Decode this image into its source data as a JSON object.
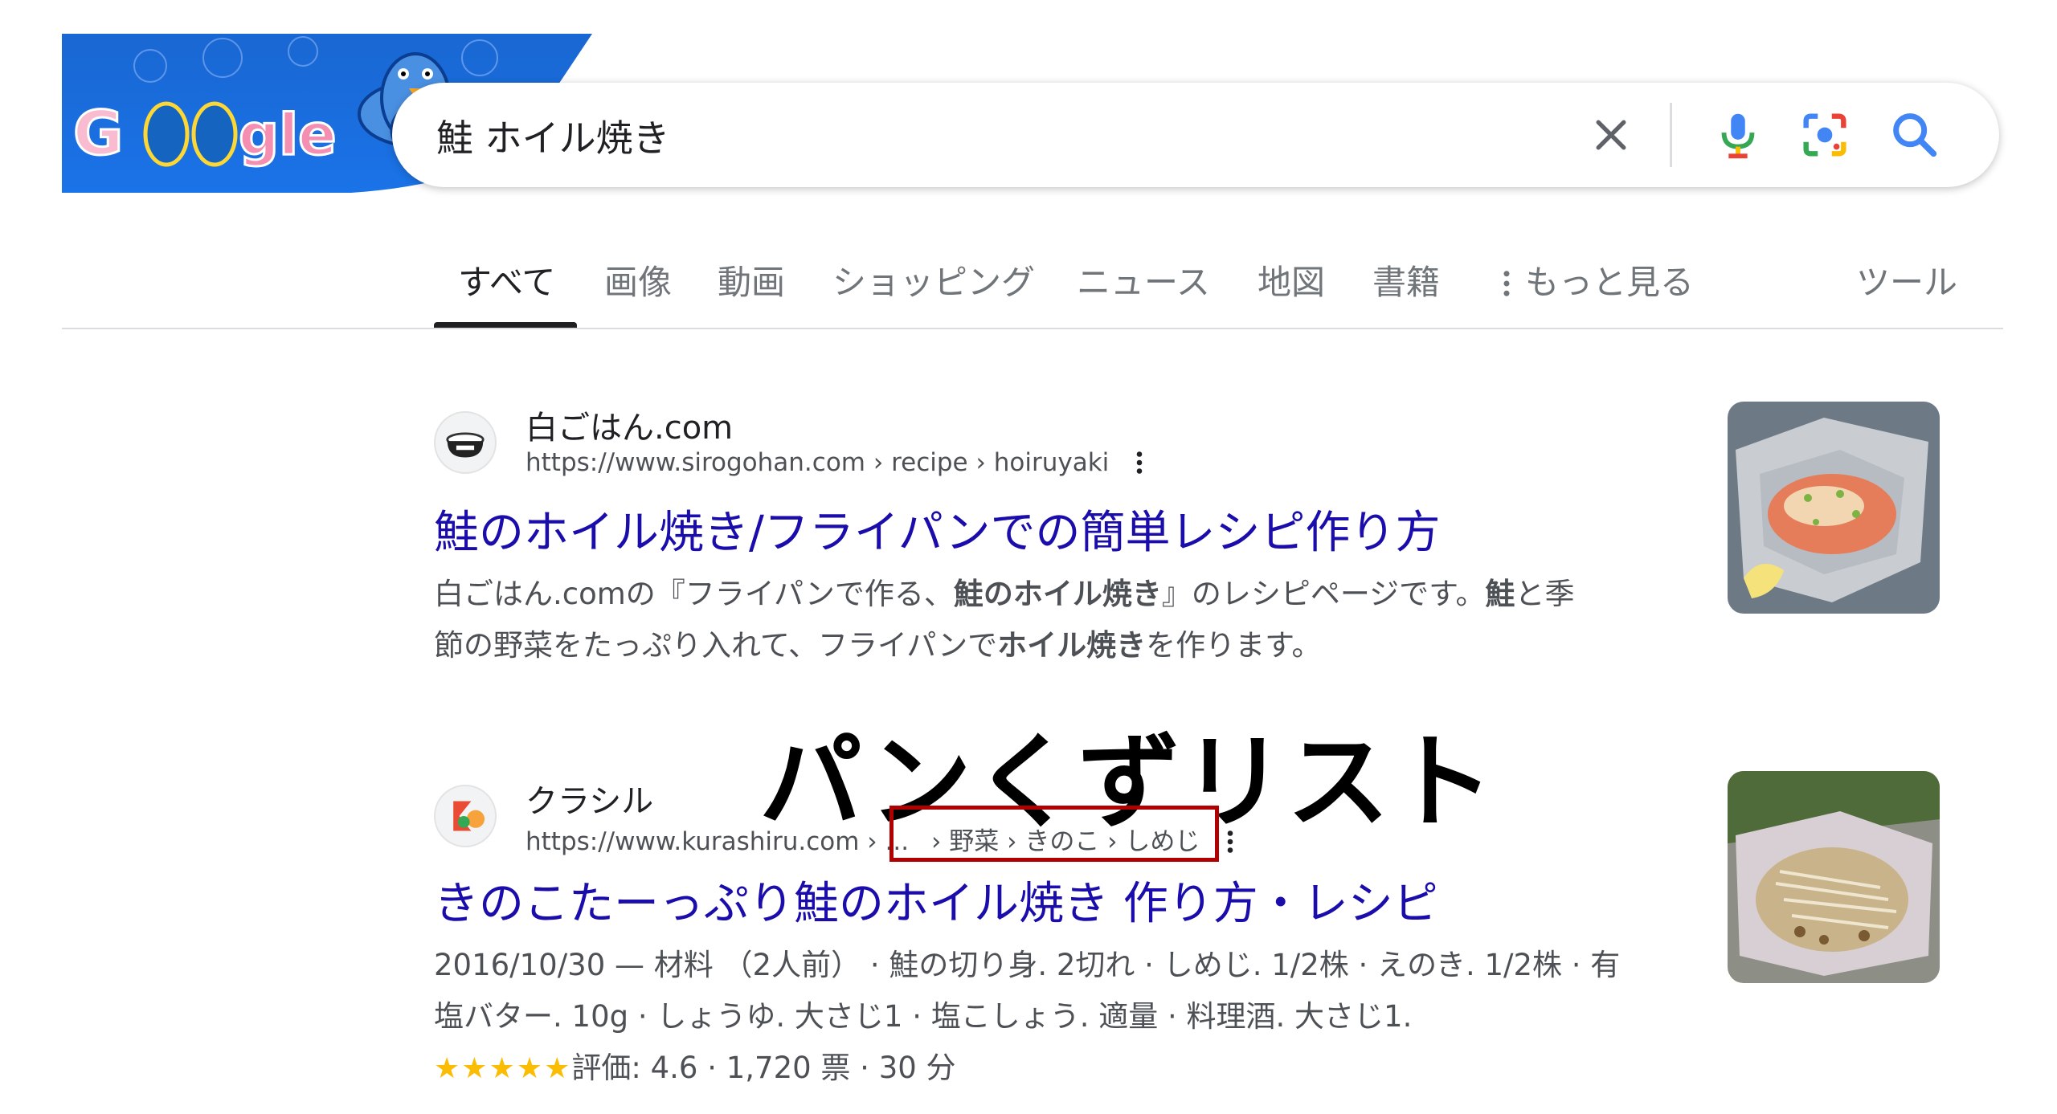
{
  "doodle": {
    "wordmark": "Google",
    "colors": {
      "banner": "#1a73e8",
      "banner_dark": "#0b57d0",
      "mascot": "#4a90e2",
      "mascot_belly": "#f28b82"
    }
  },
  "search": {
    "query": "鮭 ホイル焼き",
    "icons": [
      "close-icon",
      "microphone-icon",
      "google-lens-icon",
      "search-icon"
    ]
  },
  "tabs": {
    "items": [
      "すべて",
      "画像",
      "動画",
      "ショッピング",
      "ニュース",
      "地図",
      "書籍"
    ],
    "more_label": "もっと見る",
    "tools_label": "ツール",
    "active": "すべて"
  },
  "results": [
    {
      "site_name": "白ごはん.com",
      "url": "https://www.sirogohan.com › recipe › hoiruyaki",
      "title": "鮭のホイル焼き/フライパンでの簡単レシピ作り方",
      "snippet_line1_pre": "白ごはん.comの『フライパンで作る、",
      "snippet_line1_bold": "鮭のホイル焼き",
      "snippet_line1_post": "』のレシピページです。",
      "snippet_line1_bold2": "鮭",
      "snippet_line1_post2": "と季",
      "snippet_line2_pre": "節の野菜をたっぷり入れて、フライパンで",
      "snippet_line2_bold": "ホイル焼き",
      "snippet_line2_post": "を作ります。"
    },
    {
      "site_name": "クラシル",
      "url_host": "https://www.kurashiru.com › ...",
      "url_breadcrumb": "› 野菜 › きのこ › しめじ",
      "title": "きのこたーっぷり鮭のホイル焼き 作り方・レシピ",
      "snippet_line1": "2016/10/30 — 材料 （2人前） · 鮭の切り身. 2切れ · しめじ. 1/2株 · えのき. 1/2株 · 有",
      "snippet_line2": "塩バター. 10g · しょうゆ. 大さじ1 · 塩こしょう. 適量 · 料理酒. 大さじ1.",
      "stars": "★★★★★",
      "rating_text": "評価: 4.6 · 1,720 票 · 30 分",
      "rating_value": 4.6
    }
  ],
  "annotation": {
    "label": "パンくずリスト",
    "box_color": "#b00000"
  },
  "colors": {
    "link": "#1a0dab",
    "text": "#202124",
    "muted": "#4d5156",
    "star": "#fbbc04"
  }
}
